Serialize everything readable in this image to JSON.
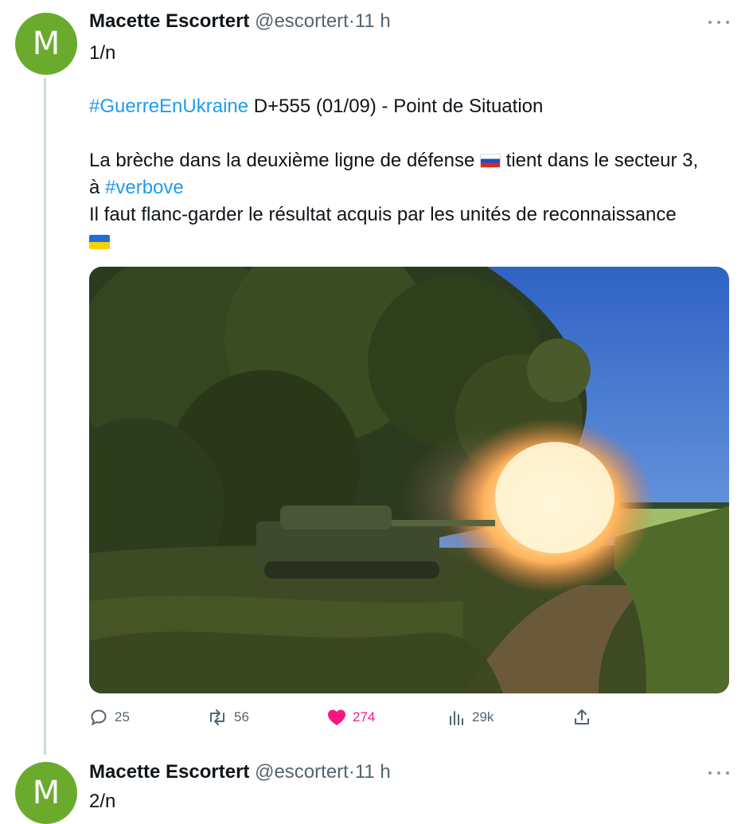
{
  "tweets": [
    {
      "avatar_letter": "M",
      "name": "Macette Escortert",
      "handle": "@escortert",
      "dot": "·",
      "time": "11 h",
      "lines": {
        "l1": "1/n",
        "l2_tag": "#GuerreEnUkraine",
        "l2_rest": " D+555 (01/09) - Point de Situation",
        "l3_a": "La brèche dans la deuxième ligne de défense ",
        "l3_b": " tient dans le secteur 3,",
        "l4_a": "à ",
        "l4_tag": "#verbove",
        "l5": "Il faut flanc-garder le résultat acquis par les unités de reconnaissance"
      },
      "flags": {
        "first": "flag-russia",
        "second": "flag-ukraine"
      },
      "media": {
        "subject": "tank firing in summer vegetation, blue sky"
      },
      "actions": {
        "replies": "25",
        "retweets": "56",
        "likes": "274",
        "views": "29k"
      }
    },
    {
      "avatar_letter": "M",
      "name": "Macette Escortert",
      "handle": "@escortert",
      "dot": "·",
      "time": "11 h",
      "lines": {
        "l1": "2/n"
      }
    }
  ],
  "colors": {
    "link": "#1d9bf0",
    "like": "#f91880",
    "muted": "#536471",
    "avatar": "#6aab2e",
    "thread": "#cfd9de"
  },
  "icons": [
    "reply-icon",
    "retweet-icon",
    "heart-icon",
    "views-icon",
    "share-icon",
    "more-icon"
  ]
}
